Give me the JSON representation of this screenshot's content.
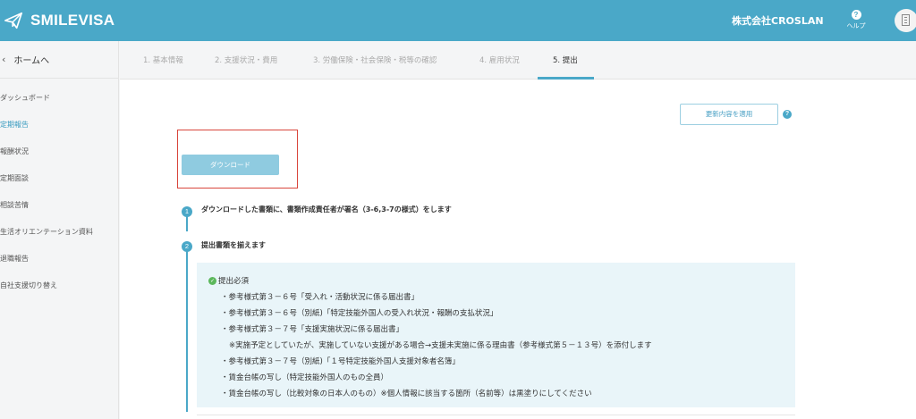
{
  "header": {
    "app_name": "SMILEVISA",
    "company": "株式会社CROSLAN",
    "help_label": "ヘルプ"
  },
  "sidebar": {
    "home_label": "ホームへ",
    "items": [
      {
        "label": "ダッシュボード",
        "active": false
      },
      {
        "label": "定期報告",
        "active": true
      },
      {
        "label": "報酬状況",
        "active": false
      },
      {
        "label": "定期面談",
        "active": false
      },
      {
        "label": "相談苦情",
        "active": false
      },
      {
        "label": "生活オリエンテーション資料",
        "active": false
      },
      {
        "label": "退職報告",
        "active": false
      },
      {
        "label": "自社支援切り替え",
        "active": false
      }
    ]
  },
  "tabs": [
    {
      "label": "1. 基本情報",
      "active": false
    },
    {
      "label": "2. 支援状況・費用",
      "active": false
    },
    {
      "label": "3. 労働保険・社会保険・税等の確認",
      "active": false
    },
    {
      "label": "4. 雇用状況",
      "active": false
    },
    {
      "label": "5. 提出",
      "active": true
    }
  ],
  "main": {
    "update_button": "更新内容を適用",
    "download_button": "ダウンロード",
    "steps": [
      {
        "num": "1",
        "text": "ダウンロードした書類に、書類作成責任者が署名（3-6,3-7の様式）をします"
      },
      {
        "num": "2",
        "text": "提出書類を揃えます"
      }
    ],
    "required": {
      "title": "提出必須",
      "items": [
        "・参考様式第３－６号「受入れ・活動状況に係る届出書」",
        "・参考様式第３－６号（別紙)「特定技能外国人の受入れ状況・報酬の支払状況」",
        "・参考様式第３－７号「支援実施状況に係る届出書」",
        "※実施予定としていたが、実施していない支援がある場合→支援未実施に係る理由書（参考様式第５－１３号）を添付します",
        "・参考様式第３－７号（別紙)「１号特定技能外国人支援対象者名簿」",
        "・賃金台帳の写し（特定技能外国人のもの全員）",
        "・賃金台帳の写し（比較対象の日本人のもの）※個人情報に該当する箇所（名前等）は黒塗りにしてください"
      ]
    }
  },
  "colors": {
    "brand": "#4aa8c8",
    "active_text": "#3a9cc0",
    "highlight": "#d9463c",
    "box_bg": "#e9f5f9",
    "check": "#5cb85c"
  },
  "icons": [
    "paper-plane-icon",
    "help-icon",
    "building-icon",
    "chevron-left-icon",
    "question-icon",
    "check-circle-icon"
  ]
}
